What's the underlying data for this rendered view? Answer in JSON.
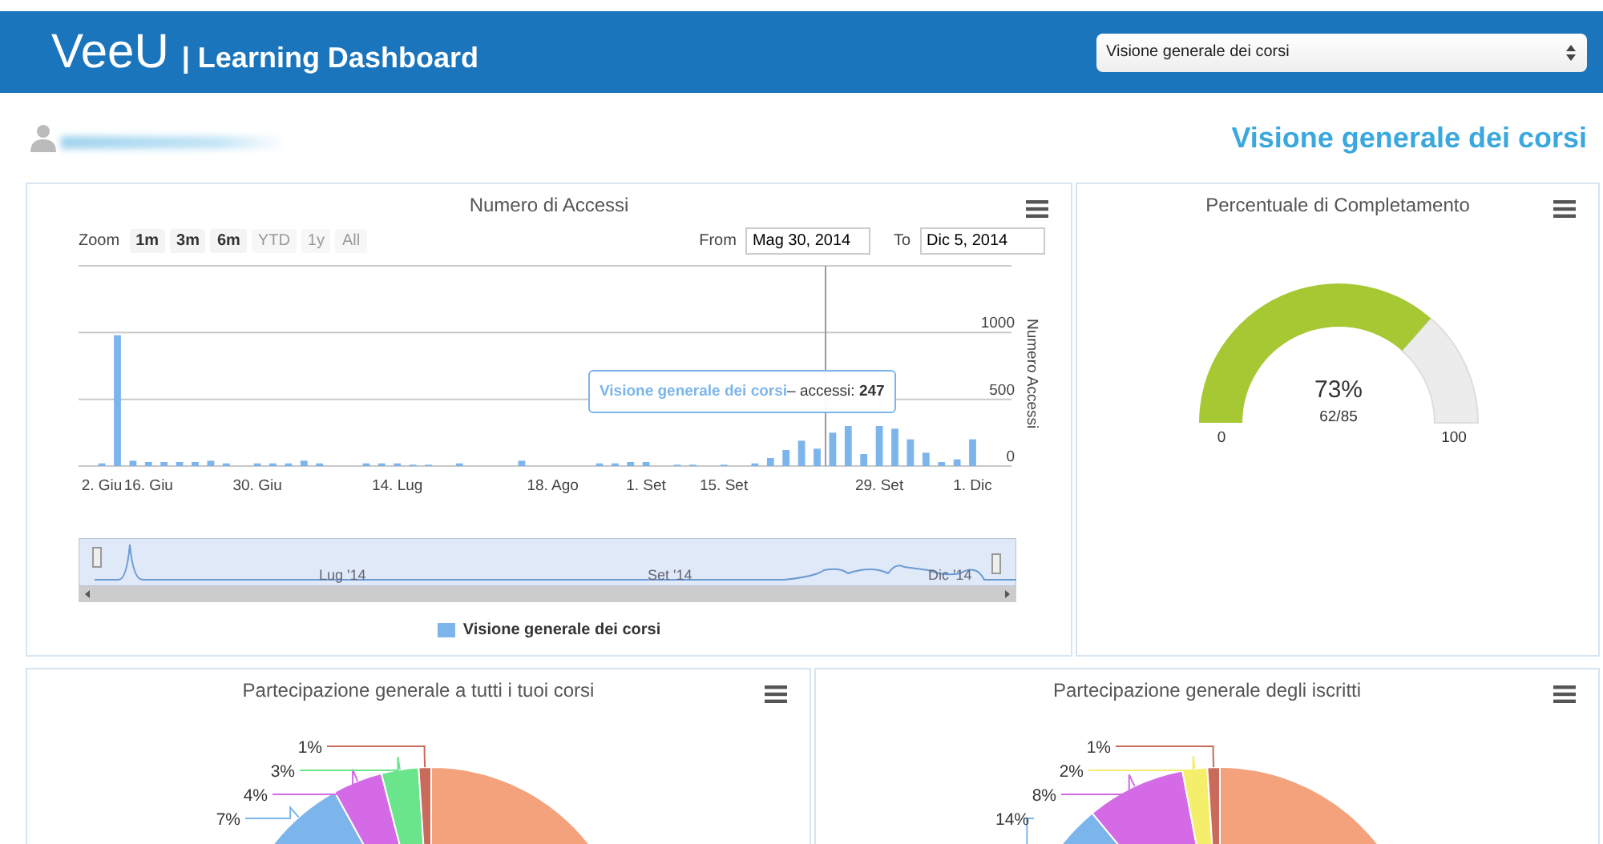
{
  "header": {
    "logo": "VeeU",
    "title": "| Learning Dashboard",
    "course_select": {
      "value": "Visione generale dei corsi"
    }
  },
  "page_title": "Visione generale dei corsi",
  "access_panel": {
    "title": "Numero di Accessi",
    "zoom_label": "Zoom",
    "zoom_buttons": [
      {
        "label": "1m",
        "disabled": false
      },
      {
        "label": "3m",
        "disabled": false
      },
      {
        "label": "6m",
        "disabled": false
      },
      {
        "label": "YTD",
        "disabled": true
      },
      {
        "label": "1y",
        "disabled": true
      },
      {
        "label": "All",
        "disabled": true
      }
    ],
    "from_label": "From",
    "from_value": "Mag 30, 2014",
    "to_label": "To",
    "to_value": "Dic 5, 2014",
    "chart_data": {
      "type": "bar",
      "ylabel": "Numero Accessi",
      "ylim": [
        0,
        1500
      ],
      "categories": [
        null,
        "2. Giu",
        null,
        null,
        "16. Giu",
        null,
        null,
        null,
        null,
        null,
        null,
        "30. Giu",
        null,
        null,
        null,
        null,
        null,
        null,
        null,
        null,
        "14. Lug",
        null,
        null,
        null,
        null,
        null,
        null,
        null,
        null,
        null,
        "18. Ago",
        null,
        null,
        null,
        null,
        null,
        "1. Set",
        null,
        null,
        null,
        null,
        "15. Set",
        null,
        null,
        null,
        null,
        null,
        null,
        null,
        null,
        null,
        "29. Set",
        null,
        null,
        null,
        null,
        null,
        "1. Dic",
        null,
        null
      ],
      "values": [
        0,
        20,
        980,
        40,
        30,
        30,
        30,
        30,
        40,
        20,
        0,
        20,
        20,
        20,
        40,
        20,
        0,
        0,
        20,
        20,
        20,
        10,
        10,
        0,
        20,
        0,
        0,
        0,
        40,
        0,
        0,
        0,
        0,
        20,
        20,
        30,
        30,
        0,
        10,
        10,
        0,
        10,
        0,
        20,
        60,
        120,
        190,
        130,
        250,
        300,
        90,
        300,
        280,
        200,
        100,
        30,
        50,
        200,
        0,
        0
      ],
      "yticks": [
        0,
        500,
        1000
      ]
    },
    "tooltip": {
      "series": "Visione generale dei corsi",
      "text": "– accessi: **247**"
    },
    "navigator": {
      "labels": [
        "Lug '14",
        "Set '14",
        "Dic '14"
      ]
    },
    "legend": [
      {
        "label": "Visione generale dei corsi",
        "color": "#7cb5ec"
      }
    ]
  },
  "gauge_panel": {
    "title": "Percentuale di Completamento",
    "value": "73%",
    "detail": "62/85",
    "min": "0",
    "max": "100"
  },
  "pie_panels": [
    {
      "title": "Partecipazione generale a tutti i tuoi corsi",
      "chart_data": {
        "type": "pie",
        "values": [
          85,
          7,
          4,
          3,
          1
        ],
        "value_labels": [
          null,
          "7%",
          "4%",
          "3%",
          "1%"
        ],
        "colors": [
          "#f4a27c",
          "#7cb5ec",
          "#d46ae6",
          "#6ae58c",
          "#c96a5a"
        ]
      }
    },
    {
      "title": "Partecipazione generale degli iscritti",
      "chart_data": {
        "type": "pie",
        "values": [
          75,
          14,
          8,
          2,
          1
        ],
        "value_labels": [
          null,
          "14%",
          "8%",
          "2%",
          "1%"
        ],
        "colors": [
          "#f4a27c",
          "#7cb5ec",
          "#d46ae6",
          "#f5ee6a",
          "#c96a5a"
        ]
      }
    }
  ]
}
